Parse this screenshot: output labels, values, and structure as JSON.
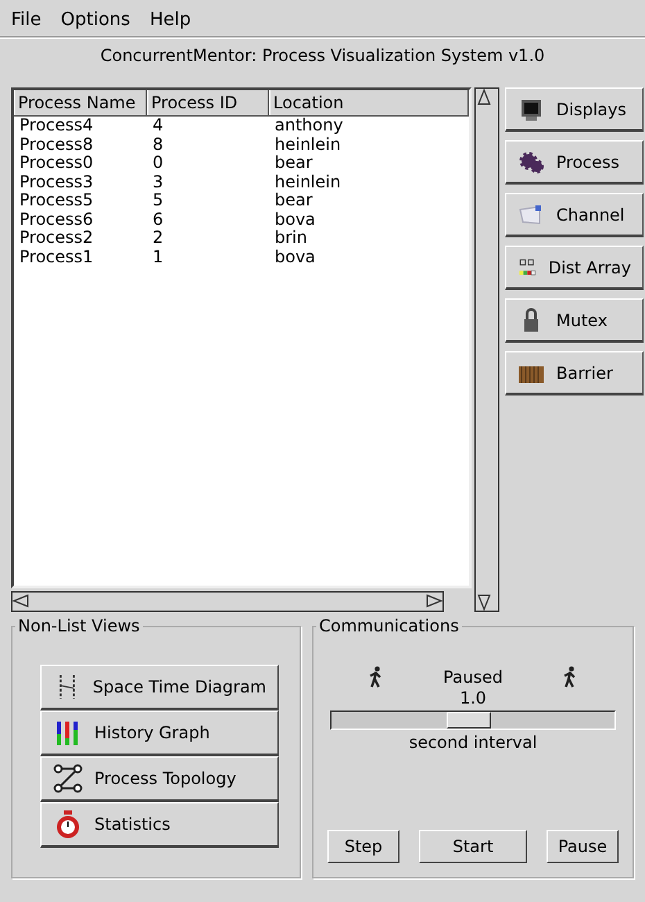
{
  "menu": [
    "File",
    "Options",
    "Help"
  ],
  "title": "ConcurrentMentor: Process Visualization System v1.0",
  "table": {
    "columns": [
      "Process Name",
      "Process ID",
      "Location"
    ],
    "rows": [
      [
        "Process4",
        "4",
        "anthony"
      ],
      [
        "Process8",
        "8",
        "heinlein"
      ],
      [
        "Process0",
        "0",
        "bear"
      ],
      [
        "Process3",
        "3",
        "heinlein"
      ],
      [
        "Process5",
        "5",
        "bear"
      ],
      [
        "Process6",
        "6",
        "bova"
      ],
      [
        "Process2",
        "2",
        "brin"
      ],
      [
        "Process1",
        "1",
        "bova"
      ]
    ]
  },
  "side_buttons": [
    {
      "kind": "displays",
      "label": "Displays"
    },
    {
      "kind": "process",
      "label": "Process"
    },
    {
      "kind": "channel",
      "label": "Channel"
    },
    {
      "kind": "array",
      "label": "Dist Array"
    },
    {
      "kind": "mutex",
      "label": "Mutex"
    },
    {
      "kind": "barrier",
      "label": "Barrier"
    }
  ],
  "views": {
    "title": "Non-List Views",
    "buttons": [
      {
        "kind": "spacetime",
        "label": "Space Time Diagram"
      },
      {
        "kind": "history",
        "label": "History Graph"
      },
      {
        "kind": "topology",
        "label": "Process Topology"
      },
      {
        "kind": "stats",
        "label": "Statistics"
      }
    ]
  },
  "communications": {
    "title": "Communications",
    "status": "Paused",
    "value": "1.0",
    "level": 0.48,
    "unit": "second interval",
    "buttons": [
      "Step",
      "Start",
      "Pause"
    ]
  }
}
